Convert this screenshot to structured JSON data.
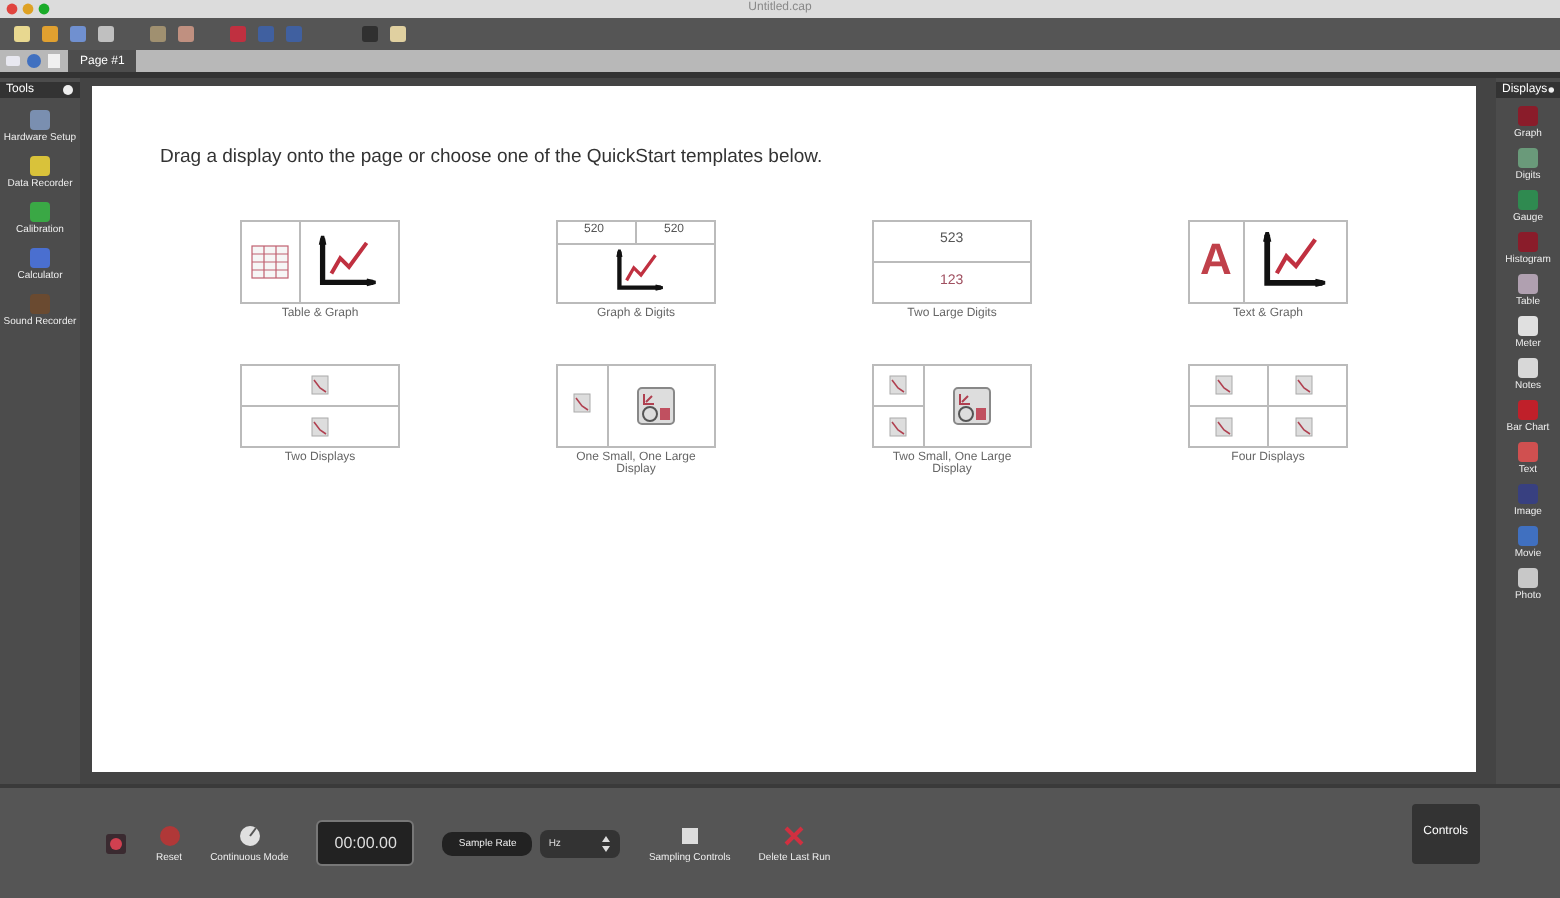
{
  "window": {
    "title": "Untitled.cap"
  },
  "page_tabs": [
    {
      "label": "Page #1",
      "selected": true
    }
  ],
  "tools_panel": {
    "title": "Tools",
    "items": [
      {
        "label": "Hardware Setup",
        "color": "#7a8fb0"
      },
      {
        "label": "Data Recorder",
        "color": "#d9c23a"
      },
      {
        "label": "Calibration",
        "color": "#3aa845"
      },
      {
        "label": "Calculator",
        "color": "#4a6fd0"
      },
      {
        "label": "Sound Recorder",
        "color": "#6a4a30"
      }
    ]
  },
  "instruction": "Drag a display onto the page or choose one of the QuickStart templates below.",
  "templates": [
    {
      "kind": "table-graph",
      "label": "Table & Graph"
    },
    {
      "kind": "graph-digits",
      "label": "Graph & Digits",
      "digits": [
        "520",
        "520"
      ]
    },
    {
      "kind": "two-digits",
      "label": "Two Large Digits",
      "digits": [
        "523",
        "123"
      ]
    },
    {
      "kind": "text-graph",
      "label": "Text & Graph",
      "letter": "A"
    },
    {
      "kind": "two",
      "label": "Two Displays"
    },
    {
      "kind": "one-small-one-large",
      "label": "One Small, One Large Display"
    },
    {
      "kind": "two-small-one-large",
      "label": "Two Small, One Large Display"
    },
    {
      "kind": "four",
      "label": "Four Displays"
    }
  ],
  "displays_panel": {
    "title": "Displays",
    "items": [
      {
        "label": "Graph",
        "color": "#8a1c2a"
      },
      {
        "label": "Digits",
        "color": "#6a9a7a"
      },
      {
        "label": "Gauge",
        "color": "#2f8a50"
      },
      {
        "label": "Histogram",
        "color": "#8a1c2a"
      },
      {
        "label": "Table",
        "color": "#b0a0b0"
      },
      {
        "label": "Meter",
        "color": "#e0e0e0"
      },
      {
        "label": "Notes",
        "color": "#d8d8d8"
      },
      {
        "label": "Bar Chart",
        "color": "#c0202a"
      },
      {
        "label": "Text",
        "color": "#d05050"
      },
      {
        "label": "Image",
        "color": "#384080"
      },
      {
        "label": "Movie",
        "color": "#4070c0"
      },
      {
        "label": "Photo",
        "color": "#c8c8c8"
      }
    ]
  },
  "bottom_bar": {
    "reset": "Reset",
    "mode": "Continuous Mode",
    "time": "00:00.00",
    "rate_menu": "Sample Rate",
    "rate_field": "Hz",
    "sampling": "Sampling Controls",
    "delete": "Delete Last Run",
    "controls_title": "Controls"
  }
}
